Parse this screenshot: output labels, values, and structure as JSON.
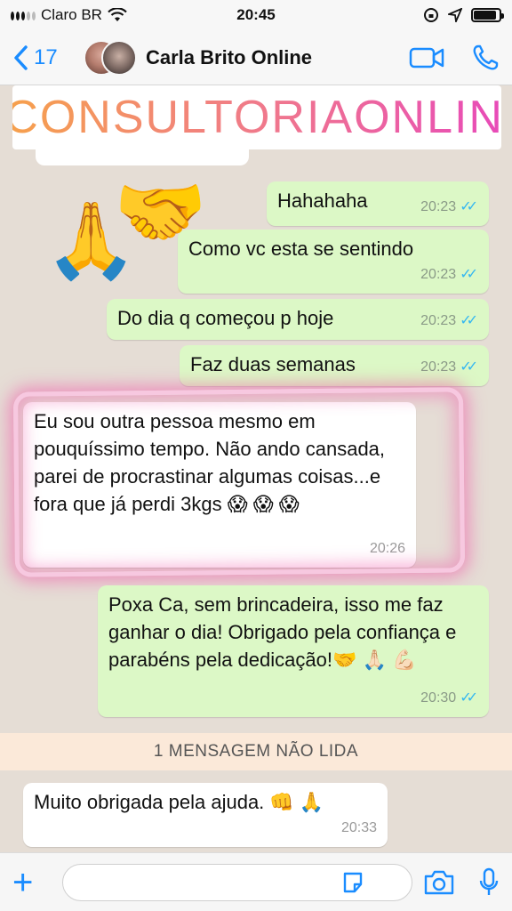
{
  "status_bar": {
    "carrier": "Claro BR",
    "time": "20:45",
    "battery_level": 0.9
  },
  "header": {
    "back_count": "17",
    "contact_name": "Carla Brito Online"
  },
  "banner": {
    "text": "#CONSULTORIAONLINE"
  },
  "emojis": {
    "pray": "🙏",
    "handshake": "🤝"
  },
  "messages": [
    {
      "direction": "out",
      "text": "Hahahaha",
      "time": "20:23",
      "ticks": "✓✓"
    },
    {
      "direction": "out",
      "text": "Como vc esta se sentindo",
      "time": "20:23",
      "ticks": "✓✓"
    },
    {
      "direction": "out",
      "text": "Do dia q começou p hoje",
      "time": "20:23",
      "ticks": "✓✓"
    },
    {
      "direction": "out",
      "text": "Faz duas semanas",
      "time": "20:23",
      "ticks": "✓✓"
    },
    {
      "direction": "in",
      "text": "Eu sou outra pessoa mesmo em pouquíssimo tempo. Não ando cansada, parei de procrastinar algumas coisas...e fora que já perdi 3kgs 😱 😱 😱",
      "time": "20:26"
    },
    {
      "direction": "out",
      "text": "Poxa Ca, sem brincadeira, isso me faz ganhar o dia! Obrigado pela confiança e parabéns pela dedicação!🤝 🙏🏻 💪🏻",
      "time": "20:30",
      "ticks": "✓✓"
    },
    {
      "direction": "in",
      "text": "Muito obrigada pela ajuda. 👊 🙏",
      "time": "20:33"
    }
  ],
  "unread_banner": "1 MENSAGEM NÃO LIDA",
  "input": {
    "plus": "+",
    "placeholder": ""
  },
  "colors": {
    "accent": "#1a8cff",
    "outgoing_bubble": "#dcf8c6",
    "incoming_bubble": "#ffffff",
    "read_ticks": "#34b7f1",
    "highlight": "#f05aaa"
  },
  "icons": [
    "back-chevron-icon",
    "video-call-icon",
    "phone-icon",
    "plus-icon",
    "sticker-icon",
    "camera-icon",
    "microphone-icon",
    "wifi-icon",
    "location-arrow-icon",
    "rotation-lock-icon"
  ]
}
